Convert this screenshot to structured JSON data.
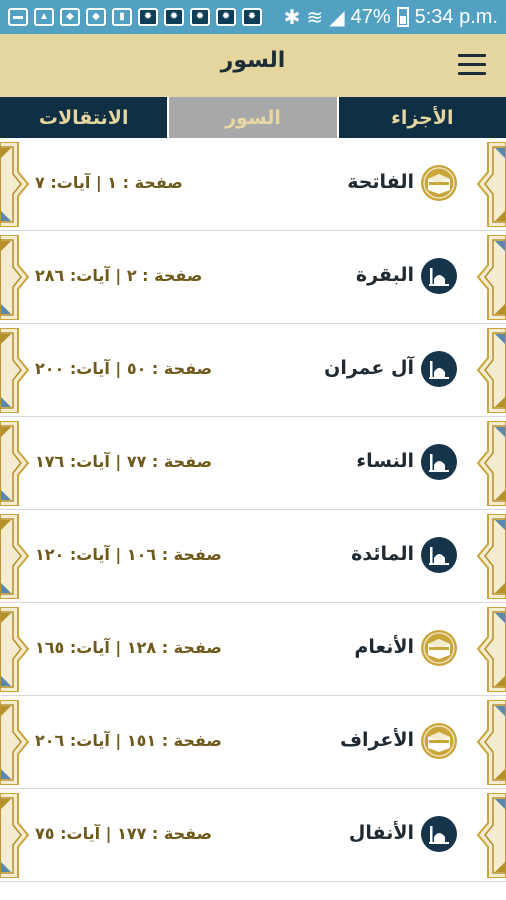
{
  "status_bar": {
    "battery": "47%",
    "time": "5:34 p.m."
  },
  "header": {
    "title": "السور"
  },
  "tabs": [
    {
      "label": "الأجزاء",
      "active": false
    },
    {
      "label": "السور",
      "active": true
    },
    {
      "label": "الانتقالات",
      "active": false
    }
  ],
  "surahs": [
    {
      "name": "الفاتحة",
      "meta": "صفحة : ١ | آيات: ٧",
      "icon": "kaaba-icon"
    },
    {
      "name": "البقرة",
      "meta": "صفحة : ٢ | آيات: ٢٨٦",
      "icon": "mosque-icon"
    },
    {
      "name": "آل عمران",
      "meta": "صفحة : ٥٠ | آيات: ٢٠٠",
      "icon": "mosque-icon"
    },
    {
      "name": "النساء",
      "meta": "صفحة : ٧٧ | آيات: ١٧٦",
      "icon": "mosque-icon"
    },
    {
      "name": "المائدة",
      "meta": "صفحة : ١٠٦ | آيات: ١٢٠",
      "icon": "mosque-icon"
    },
    {
      "name": "الأنعام",
      "meta": "صفحة : ١٢٨ | آيات: ١٦٥",
      "icon": "kaaba-icon"
    },
    {
      "name": "الأعراف",
      "meta": "صفحة : ١٥١ | آيات: ٢٠٦",
      "icon": "kaaba-icon"
    },
    {
      "name": "الأنفال",
      "meta": "صفحة : ١٧٧ | آيات: ٧٥",
      "icon": "mosque-icon"
    }
  ],
  "colors": {
    "status_bar": "#53a1c2",
    "app_bar": "#e5d59f",
    "tab_dark": "#0f2f44",
    "tab_active": "#a7a8a9",
    "gold": "#c9a53a",
    "navy": "#16344a"
  }
}
